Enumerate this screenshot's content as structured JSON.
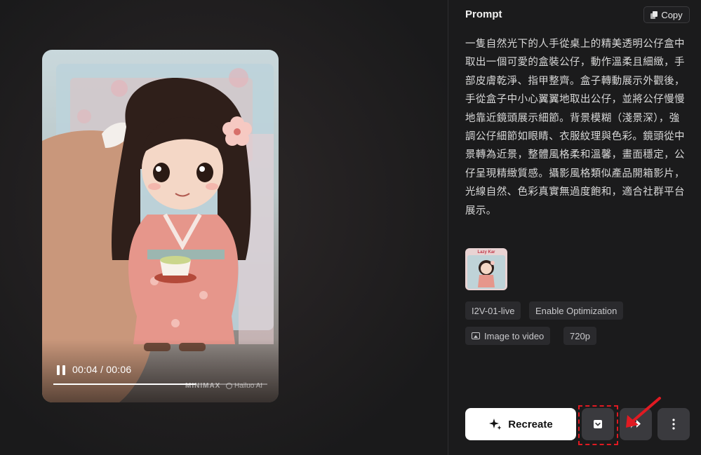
{
  "player": {
    "time": "00:04 / 00:06",
    "progress_fraction": 0.667,
    "watermark_left": "MINIMAX",
    "watermark_right": "Hailuo AI"
  },
  "panel": {
    "title": "Prompt",
    "copy_label": "Copy",
    "prompt_text": "一隻自然光下的人手從桌上的精美透明公仔盒中取出一個可愛的盒裝公仔，動作溫柔且細緻，手部皮膚乾淨、指甲整齊。盒子轉動展示外觀後，手從盒子中小心翼翼地取出公仔，並將公仔慢慢地靠近鏡頭展示細節。背景模糊（淺景深），強調公仔細節如眼睛、衣服紋理與色彩。鏡頭從中景轉為近景，整體風格柔和溫馨，畫面穩定，公仔呈現精緻質感。攝影風格類似產品開箱影片，光線自然、色彩真實無過度飽和，適合社群平台展示。",
    "thumbnail_label": "Lazy Kar",
    "tags": {
      "model": "I2V-01-live",
      "optimization": "Enable Optimization",
      "mode": "Image to video",
      "resolution": "720p"
    }
  },
  "actions": {
    "recreate_label": "Recreate",
    "download_icon": "download-icon",
    "share_icon": "share-icon",
    "more_icon": "more-vertical-icon"
  },
  "annotation": {
    "highlight_color": "#e01a22"
  }
}
